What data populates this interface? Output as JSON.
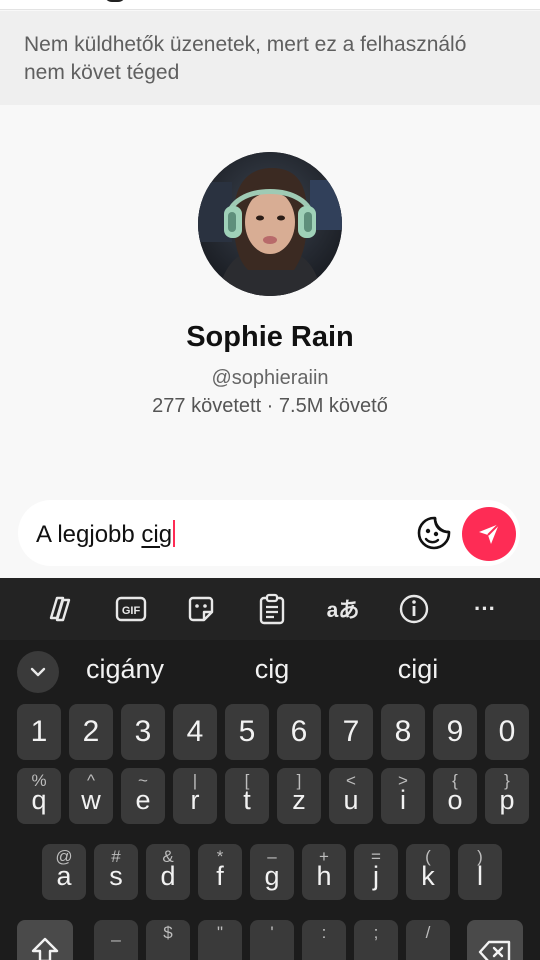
{
  "notice": {
    "line1": "Nem küldhetők üzenetek, mert ez a felhasználó",
    "line2": "nem követ téged"
  },
  "profile": {
    "name": "Sophie Rain",
    "handle": "@sophieraiin",
    "stats": "277 követett · 7.5M követő"
  },
  "composer": {
    "text_plain": "A legjobb ",
    "text_underlined": "cig",
    "accent_color": "#fe2c55"
  },
  "keyboard": {
    "toolbar": [
      "copilot-icon",
      "gif-icon",
      "sticker-icon",
      "clipboard-icon",
      "translate-icon",
      "info-icon",
      "more-icon"
    ],
    "translate_label": "aあ",
    "gif_label": "GIF",
    "more_label": "···",
    "suggestions": [
      "cigány",
      "cig",
      "cigi"
    ],
    "number_row": [
      "1",
      "2",
      "3",
      "4",
      "5",
      "6",
      "7",
      "8",
      "9",
      "0"
    ],
    "row_q": [
      {
        "main": "q",
        "alt": "%"
      },
      {
        "main": "w",
        "alt": "^"
      },
      {
        "main": "e",
        "alt": "~"
      },
      {
        "main": "r",
        "alt": "|"
      },
      {
        "main": "t",
        "alt": "["
      },
      {
        "main": "z",
        "alt": "]"
      },
      {
        "main": "u",
        "alt": "<"
      },
      {
        "main": "i",
        "alt": ">"
      },
      {
        "main": "o",
        "alt": "{"
      },
      {
        "main": "p",
        "alt": "}"
      }
    ],
    "row_a": [
      {
        "main": "a",
        "alt": "@"
      },
      {
        "main": "s",
        "alt": "#"
      },
      {
        "main": "d",
        "alt": "&"
      },
      {
        "main": "f",
        "alt": "*"
      },
      {
        "main": "g",
        "alt": "–"
      },
      {
        "main": "h",
        "alt": "+"
      },
      {
        "main": "j",
        "alt": "="
      },
      {
        "main": "k",
        "alt": "("
      },
      {
        "main": "l",
        "alt": ")"
      }
    ],
    "row_y_alts": [
      "_",
      "$",
      "\"",
      "'",
      ":",
      ";",
      "/"
    ]
  }
}
